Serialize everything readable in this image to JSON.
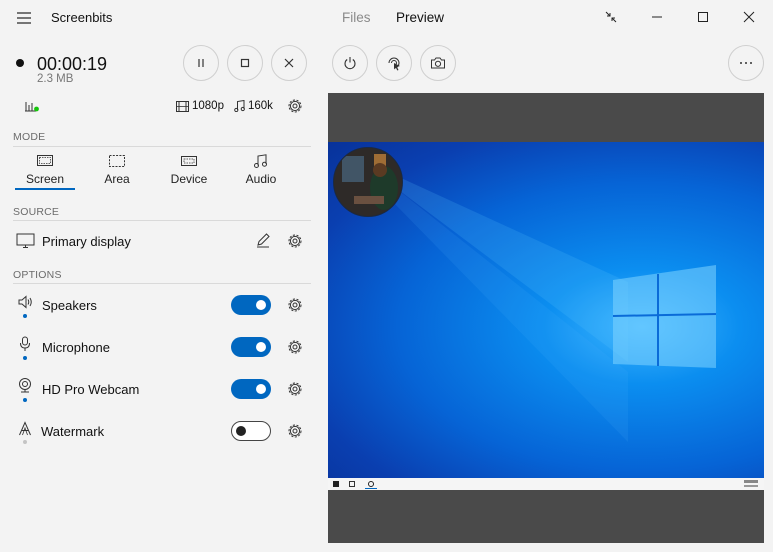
{
  "app": {
    "title": "Screenbits"
  },
  "tabs": [
    {
      "label": "Files",
      "active": false
    },
    {
      "label": "Preview",
      "active": true
    }
  ],
  "recording": {
    "timer": "00:00:19",
    "size": "2.3 MB",
    "resolution": "1080p",
    "bitrate": "160k"
  },
  "sections": {
    "mode": "MODE",
    "source": "SOURCE",
    "options": "OPTIONS"
  },
  "modes": [
    {
      "label": "Screen",
      "active": true
    },
    {
      "label": "Area",
      "active": false
    },
    {
      "label": "Device",
      "active": false
    },
    {
      "label": "Audio",
      "active": false
    }
  ],
  "source": {
    "label": "Primary display"
  },
  "options": [
    {
      "label": "Speakers",
      "enabled": true
    },
    {
      "label": "Microphone",
      "enabled": true
    },
    {
      "label": "HD Pro Webcam",
      "enabled": true
    },
    {
      "label": "Watermark",
      "enabled": false
    }
  ],
  "colors": {
    "accent": "#0067c0",
    "level_indicator": "#16c60c",
    "background": "#f3f3f3"
  },
  "icons": {
    "menu": "hamburger-icon",
    "restore": "compress-arrows-icon",
    "minimize": "minimize-icon",
    "maximize": "maximize-icon",
    "close": "close-icon",
    "pause": "pause-icon",
    "stop": "stop-icon",
    "cancel": "x-icon",
    "power": "power-icon",
    "cursor": "cursor-click-icon",
    "camera": "camera-icon",
    "more": "more-dots-icon"
  }
}
